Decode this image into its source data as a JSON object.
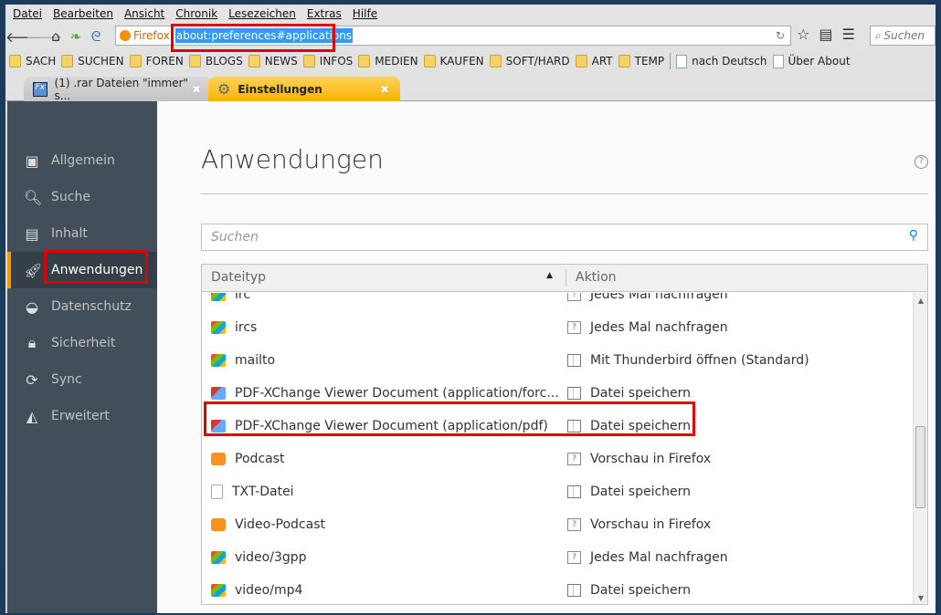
{
  "menu": [
    "Datei",
    "Bearbeiten",
    "Ansicht",
    "Chronik",
    "Lesezeichen",
    "Extras",
    "Hilfe"
  ],
  "urlbar": {
    "identity": "Firefox",
    "url": "about:preferences#applications"
  },
  "search_placeholder": "Suchen",
  "bookmarks": [
    {
      "label": "SACH",
      "type": "folder"
    },
    {
      "label": "SUCHEN",
      "type": "folder"
    },
    {
      "label": "FOREN",
      "type": "folder"
    },
    {
      "label": "BLOGS",
      "type": "folder"
    },
    {
      "label": "NEWS",
      "type": "folder"
    },
    {
      "label": "INFOS",
      "type": "folder"
    },
    {
      "label": "MEDIEN",
      "type": "folder"
    },
    {
      "label": "KAUFEN",
      "type": "folder"
    },
    {
      "label": "SOFT/HARD",
      "type": "folder"
    },
    {
      "label": "ART",
      "type": "folder"
    },
    {
      "label": "TEMP",
      "type": "folder"
    },
    {
      "label": "nach Deutsch",
      "type": "page"
    },
    {
      "label": "Über About",
      "type": "page"
    }
  ],
  "tabs": [
    {
      "label": "(1) .rar Dateien \"immer\" s...",
      "icon": "Fx"
    },
    {
      "label": "Einstellungen"
    }
  ],
  "sidebar": [
    "Allgemein",
    "Suche",
    "Inhalt",
    "Anwendungen",
    "Datenschutz",
    "Sicherheit",
    "Sync",
    "Erweitert"
  ],
  "main": {
    "title": "Anwendungen",
    "help": "?",
    "search_placeholder": "Suchen",
    "col1": "Dateityp",
    "col2": "Aktion",
    "rows": [
      {
        "type": "irc",
        "action": "Jedes Mal nachfragen",
        "ti": "app",
        "ai": "ask"
      },
      {
        "type": "ircs",
        "action": "Jedes Mal nachfragen",
        "ti": "app",
        "ai": "ask"
      },
      {
        "type": "mailto",
        "action": "Mit Thunderbird öffnen (Standard)",
        "ti": "app",
        "ai": "save"
      },
      {
        "type": "PDF-XChange Viewer Document (application/forc...",
        "action": "Datei speichern",
        "ti": "pdf",
        "ai": "save"
      },
      {
        "type": "PDF-XChange Viewer Document (application/pdf)",
        "action": "Datei speichern",
        "ti": "pdf",
        "ai": "save"
      },
      {
        "type": "Podcast",
        "action": "Vorschau in Firefox",
        "ti": "rss",
        "ai": "ask"
      },
      {
        "type": "TXT-Datei",
        "action": "Datei speichern",
        "ti": "txt",
        "ai": "save"
      },
      {
        "type": "Video-Podcast",
        "action": "Vorschau in Firefox",
        "ti": "rss",
        "ai": "ask"
      },
      {
        "type": "video/3gpp",
        "action": "Jedes Mal nachfragen",
        "ti": "app",
        "ai": "ask"
      },
      {
        "type": "video/mp4",
        "action": "Datei speichern",
        "ti": "app",
        "ai": "save"
      }
    ]
  }
}
